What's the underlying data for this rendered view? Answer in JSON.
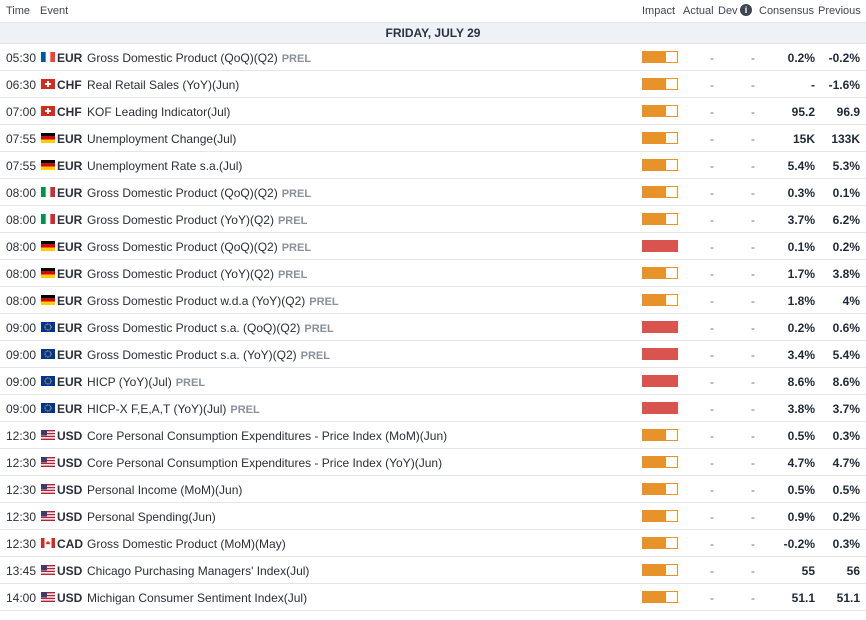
{
  "header": {
    "time": "Time",
    "event": "Event",
    "impact": "Impact",
    "actual": "Actual",
    "dev": "Dev",
    "consensus": "Consensus",
    "previous": "Previous",
    "info_icon": "i"
  },
  "date_label": "FRIDAY, JULY 29",
  "colors": {
    "medium": "#e8922a",
    "high": "#d9534f",
    "empty": "#ffffff"
  },
  "rows": [
    {
      "time": "05:30",
      "flag": "fr",
      "cur": "EUR",
      "ev": "Gross Domestic Product (QoQ)(Q2)",
      "prel": "PREL",
      "imp": "medium",
      "actual": "-",
      "dev": "-",
      "cons": "0.2%",
      "prev": "-0.2%"
    },
    {
      "time": "06:30",
      "flag": "ch",
      "cur": "CHF",
      "ev": "Real Retail Sales (YoY)(Jun)",
      "prel": "",
      "imp": "medium",
      "actual": "-",
      "dev": "-",
      "cons": "-",
      "prev": "-1.6%"
    },
    {
      "time": "07:00",
      "flag": "ch",
      "cur": "CHF",
      "ev": "KOF Leading Indicator(Jul)",
      "prel": "",
      "imp": "medium",
      "actual": "-",
      "dev": "-",
      "cons": "95.2",
      "prev": "96.9"
    },
    {
      "time": "07:55",
      "flag": "de",
      "cur": "EUR",
      "ev": "Unemployment Change(Jul)",
      "prel": "",
      "imp": "medium",
      "actual": "-",
      "dev": "-",
      "cons": "15K",
      "prev": "133K"
    },
    {
      "time": "07:55",
      "flag": "de",
      "cur": "EUR",
      "ev": "Unemployment Rate s.a.(Jul)",
      "prel": "",
      "imp": "medium",
      "actual": "-",
      "dev": "-",
      "cons": "5.4%",
      "prev": "5.3%"
    },
    {
      "time": "08:00",
      "flag": "it",
      "cur": "EUR",
      "ev": "Gross Domestic Product (QoQ)(Q2)",
      "prel": "PREL",
      "imp": "medium",
      "actual": "-",
      "dev": "-",
      "cons": "0.3%",
      "prev": "0.1%"
    },
    {
      "time": "08:00",
      "flag": "it",
      "cur": "EUR",
      "ev": "Gross Domestic Product (YoY)(Q2)",
      "prel": "PREL",
      "imp": "medium",
      "actual": "-",
      "dev": "-",
      "cons": "3.7%",
      "prev": "6.2%"
    },
    {
      "time": "08:00",
      "flag": "de",
      "cur": "EUR",
      "ev": "Gross Domestic Product (QoQ)(Q2)",
      "prel": "PREL",
      "imp": "high",
      "actual": "-",
      "dev": "-",
      "cons": "0.1%",
      "prev": "0.2%"
    },
    {
      "time": "08:00",
      "flag": "de",
      "cur": "EUR",
      "ev": "Gross Domestic Product (YoY)(Q2)",
      "prel": "PREL",
      "imp": "medium",
      "actual": "-",
      "dev": "-",
      "cons": "1.7%",
      "prev": "3.8%"
    },
    {
      "time": "08:00",
      "flag": "de",
      "cur": "EUR",
      "ev": "Gross Domestic Product w.d.a (YoY)(Q2)",
      "prel": "PREL",
      "imp": "medium",
      "actual": "-",
      "dev": "-",
      "cons": "1.8%",
      "prev": "4%"
    },
    {
      "time": "09:00",
      "flag": "eu",
      "cur": "EUR",
      "ev": "Gross Domestic Product s.a. (QoQ)(Q2)",
      "prel": "PREL",
      "imp": "high",
      "actual": "-",
      "dev": "-",
      "cons": "0.2%",
      "prev": "0.6%"
    },
    {
      "time": "09:00",
      "flag": "eu",
      "cur": "EUR",
      "ev": "Gross Domestic Product s.a. (YoY)(Q2)",
      "prel": "PREL",
      "imp": "high",
      "actual": "-",
      "dev": "-",
      "cons": "3.4%",
      "prev": "5.4%"
    },
    {
      "time": "09:00",
      "flag": "eu",
      "cur": "EUR",
      "ev": "HICP (YoY)(Jul)",
      "prel": "PREL",
      "imp": "high",
      "actual": "-",
      "dev": "-",
      "cons": "8.6%",
      "prev": "8.6%"
    },
    {
      "time": "09:00",
      "flag": "eu",
      "cur": "EUR",
      "ev": "HICP-X F,E,A,T (YoY)(Jul)",
      "prel": "PREL",
      "imp": "high",
      "actual": "-",
      "dev": "-",
      "cons": "3.8%",
      "prev": "3.7%"
    },
    {
      "time": "12:30",
      "flag": "us",
      "cur": "USD",
      "ev": "Core Personal Consumption Expenditures - Price Index (MoM)(Jun)",
      "prel": "",
      "imp": "medium",
      "actual": "-",
      "dev": "-",
      "cons": "0.5%",
      "prev": "0.3%"
    },
    {
      "time": "12:30",
      "flag": "us",
      "cur": "USD",
      "ev": "Core Personal Consumption Expenditures - Price Index (YoY)(Jun)",
      "prel": "",
      "imp": "medium",
      "actual": "-",
      "dev": "-",
      "cons": "4.7%",
      "prev": "4.7%"
    },
    {
      "time": "12:30",
      "flag": "us",
      "cur": "USD",
      "ev": "Personal Income (MoM)(Jun)",
      "prel": "",
      "imp": "medium",
      "actual": "-",
      "dev": "-",
      "cons": "0.5%",
      "prev": "0.5%"
    },
    {
      "time": "12:30",
      "flag": "us",
      "cur": "USD",
      "ev": "Personal Spending(Jun)",
      "prel": "",
      "imp": "medium",
      "actual": "-",
      "dev": "-",
      "cons": "0.9%",
      "prev": "0.2%"
    },
    {
      "time": "12:30",
      "flag": "ca",
      "cur": "CAD",
      "ev": "Gross Domestic Product (MoM)(May)",
      "prel": "",
      "imp": "medium",
      "actual": "-",
      "dev": "-",
      "cons": "-0.2%",
      "prev": "0.3%"
    },
    {
      "time": "13:45",
      "flag": "us",
      "cur": "USD",
      "ev": "Chicago Purchasing Managers' Index(Jul)",
      "prel": "",
      "imp": "medium",
      "actual": "-",
      "dev": "-",
      "cons": "55",
      "prev": "56"
    },
    {
      "time": "14:00",
      "flag": "us",
      "cur": "USD",
      "ev": "Michigan Consumer Sentiment Index(Jul)",
      "prel": "",
      "imp": "medium",
      "actual": "-",
      "dev": "-",
      "cons": "51.1",
      "prev": "51.1"
    }
  ]
}
